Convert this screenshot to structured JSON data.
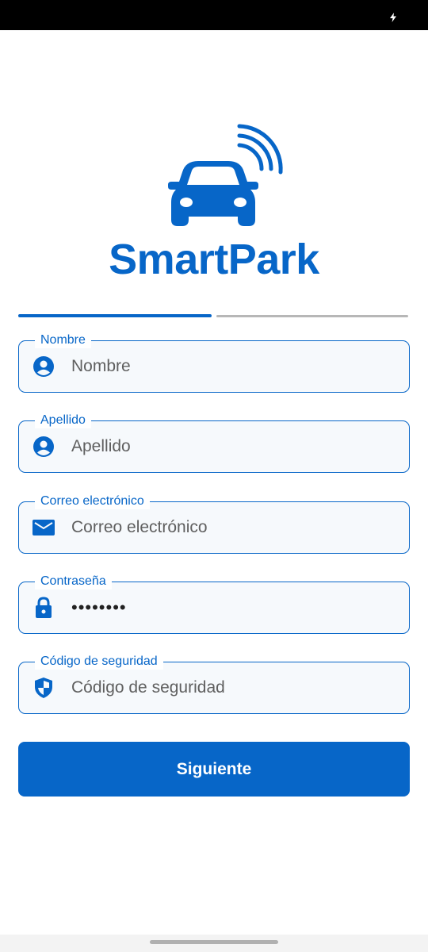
{
  "app": {
    "brand_name": "SmartPark",
    "brand_color": "#0766c8"
  },
  "progress": {
    "current_step": 1,
    "total_steps": 2
  },
  "form": {
    "fields": [
      {
        "label": "Nombre",
        "placeholder": "Nombre",
        "value": "",
        "icon": "person-icon"
      },
      {
        "label": "Apellido",
        "placeholder": "Apellido",
        "value": "",
        "icon": "person-icon"
      },
      {
        "label": "Correo electrónico",
        "placeholder": "Correo electrónico",
        "value": "",
        "icon": "mail-icon"
      },
      {
        "label": "Contraseña",
        "placeholder": "",
        "value": "••••••••",
        "icon": "lock-icon"
      },
      {
        "label": "Código de seguridad",
        "placeholder": "Código de seguridad",
        "value": "",
        "icon": "shield-icon"
      }
    ],
    "submit_label": "Siguiente"
  }
}
